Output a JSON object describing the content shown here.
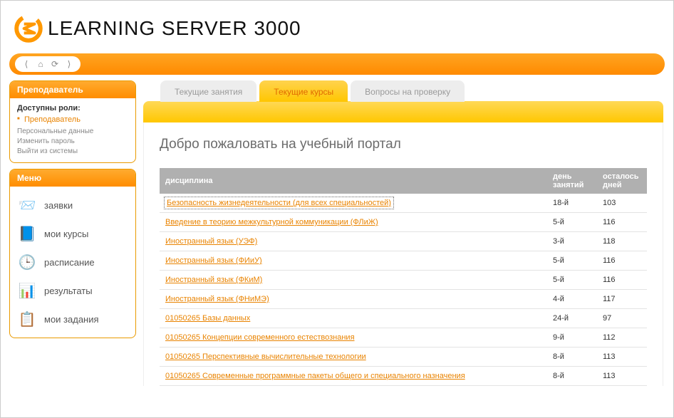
{
  "brand": {
    "text": "Learning Server  3000"
  },
  "sidebar": {
    "panel1": {
      "title": "Преподаватель",
      "roles_label": "Доступны роли:",
      "role": "Преподаватель",
      "links": [
        "Персональные данные",
        "Изменить пароль",
        "Выйти из системы"
      ]
    },
    "panel2": {
      "title": "Меню"
    },
    "menu": [
      {
        "icon": "📨",
        "label": "заявки"
      },
      {
        "icon": "📘",
        "label": "мои курсы"
      },
      {
        "icon": "🕒",
        "label": "расписание"
      },
      {
        "icon": "📊",
        "label": "результаты"
      },
      {
        "icon": "📋",
        "label": "мои задания"
      }
    ]
  },
  "tabs": [
    "Текущие занятия",
    "Текущие курсы",
    "Вопросы на проверку"
  ],
  "active_tab": 1,
  "welcome": "Добро пожаловать на учебный портал",
  "table": {
    "headers": [
      "дисциплина",
      "день занятий",
      "осталось дней"
    ],
    "rows": [
      {
        "name": "Безопасность жизнедеятельности (для всех специальностей)",
        "day": "18-й",
        "left": "103",
        "selected": true
      },
      {
        "name": "Введение в теорию межкультурной коммуникации (ФЛиЖ)",
        "day": "5-й",
        "left": "116"
      },
      {
        "name": "Иностранный язык (УЭФ)",
        "day": "3-й",
        "left": "118"
      },
      {
        "name": "Иностранный язык (ФИиУ)",
        "day": "5-й",
        "left": "116"
      },
      {
        "name": "Иностранный язык (ФКиМ)",
        "day": "5-й",
        "left": "116"
      },
      {
        "name": "Иностранный язык (ФНиМЭ)",
        "day": "4-й",
        "left": "117"
      },
      {
        "name": "01050265 Базы данных",
        "day": "24-й",
        "left": "97"
      },
      {
        "name": "01050265 Концепции современного естествознания",
        "day": "9-й",
        "left": "112"
      },
      {
        "name": "01050265 Перспективные вычислительные технологии",
        "day": "8-й",
        "left": "113"
      },
      {
        "name": "01050265 Современные программные пакеты общего и специального назначения",
        "day": "8-й",
        "left": "113"
      }
    ]
  }
}
